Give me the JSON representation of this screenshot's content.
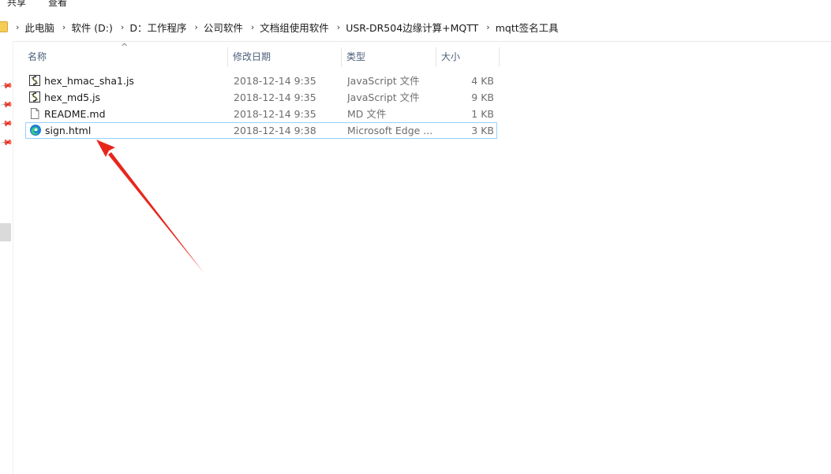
{
  "ribbon": {
    "tabs": [
      "共享",
      "查看"
    ]
  },
  "address": {
    "folder_icon": "folder-icon",
    "crumbs": [
      "此电脑",
      "软件 (D:)",
      "D：工作程序",
      "公司软件",
      "文档组使用软件",
      "USR-DR504边缘计算+MQTT",
      "mqtt签名工具"
    ],
    "separator": "›"
  },
  "columns": {
    "name": "名称",
    "date": "修改日期",
    "type": "类型",
    "size": "大小",
    "sort_indicator": "^"
  },
  "files": [
    {
      "name": "hex_hmac_sha1.js",
      "date": "2018-12-14 9:35",
      "type": "JavaScript 文件",
      "size": "4 KB",
      "icon": "script-file-icon"
    },
    {
      "name": "hex_md5.js",
      "date": "2018-12-14 9:35",
      "type": "JavaScript 文件",
      "size": "9 KB",
      "icon": "script-file-icon"
    },
    {
      "name": "README.md",
      "date": "2018-12-14 9:35",
      "type": "MD 文件",
      "size": "1 KB",
      "icon": "blank-file-icon"
    },
    {
      "name": "sign.html",
      "date": "2018-12-14 9:38",
      "type": "Microsoft Edge ...",
      "size": "3 KB",
      "icon": "edge-html-icon"
    }
  ],
  "colors": {
    "selection_border": "#99d1ff",
    "header_text": "#4c607a",
    "annotation_arrow": "#e8261c"
  }
}
